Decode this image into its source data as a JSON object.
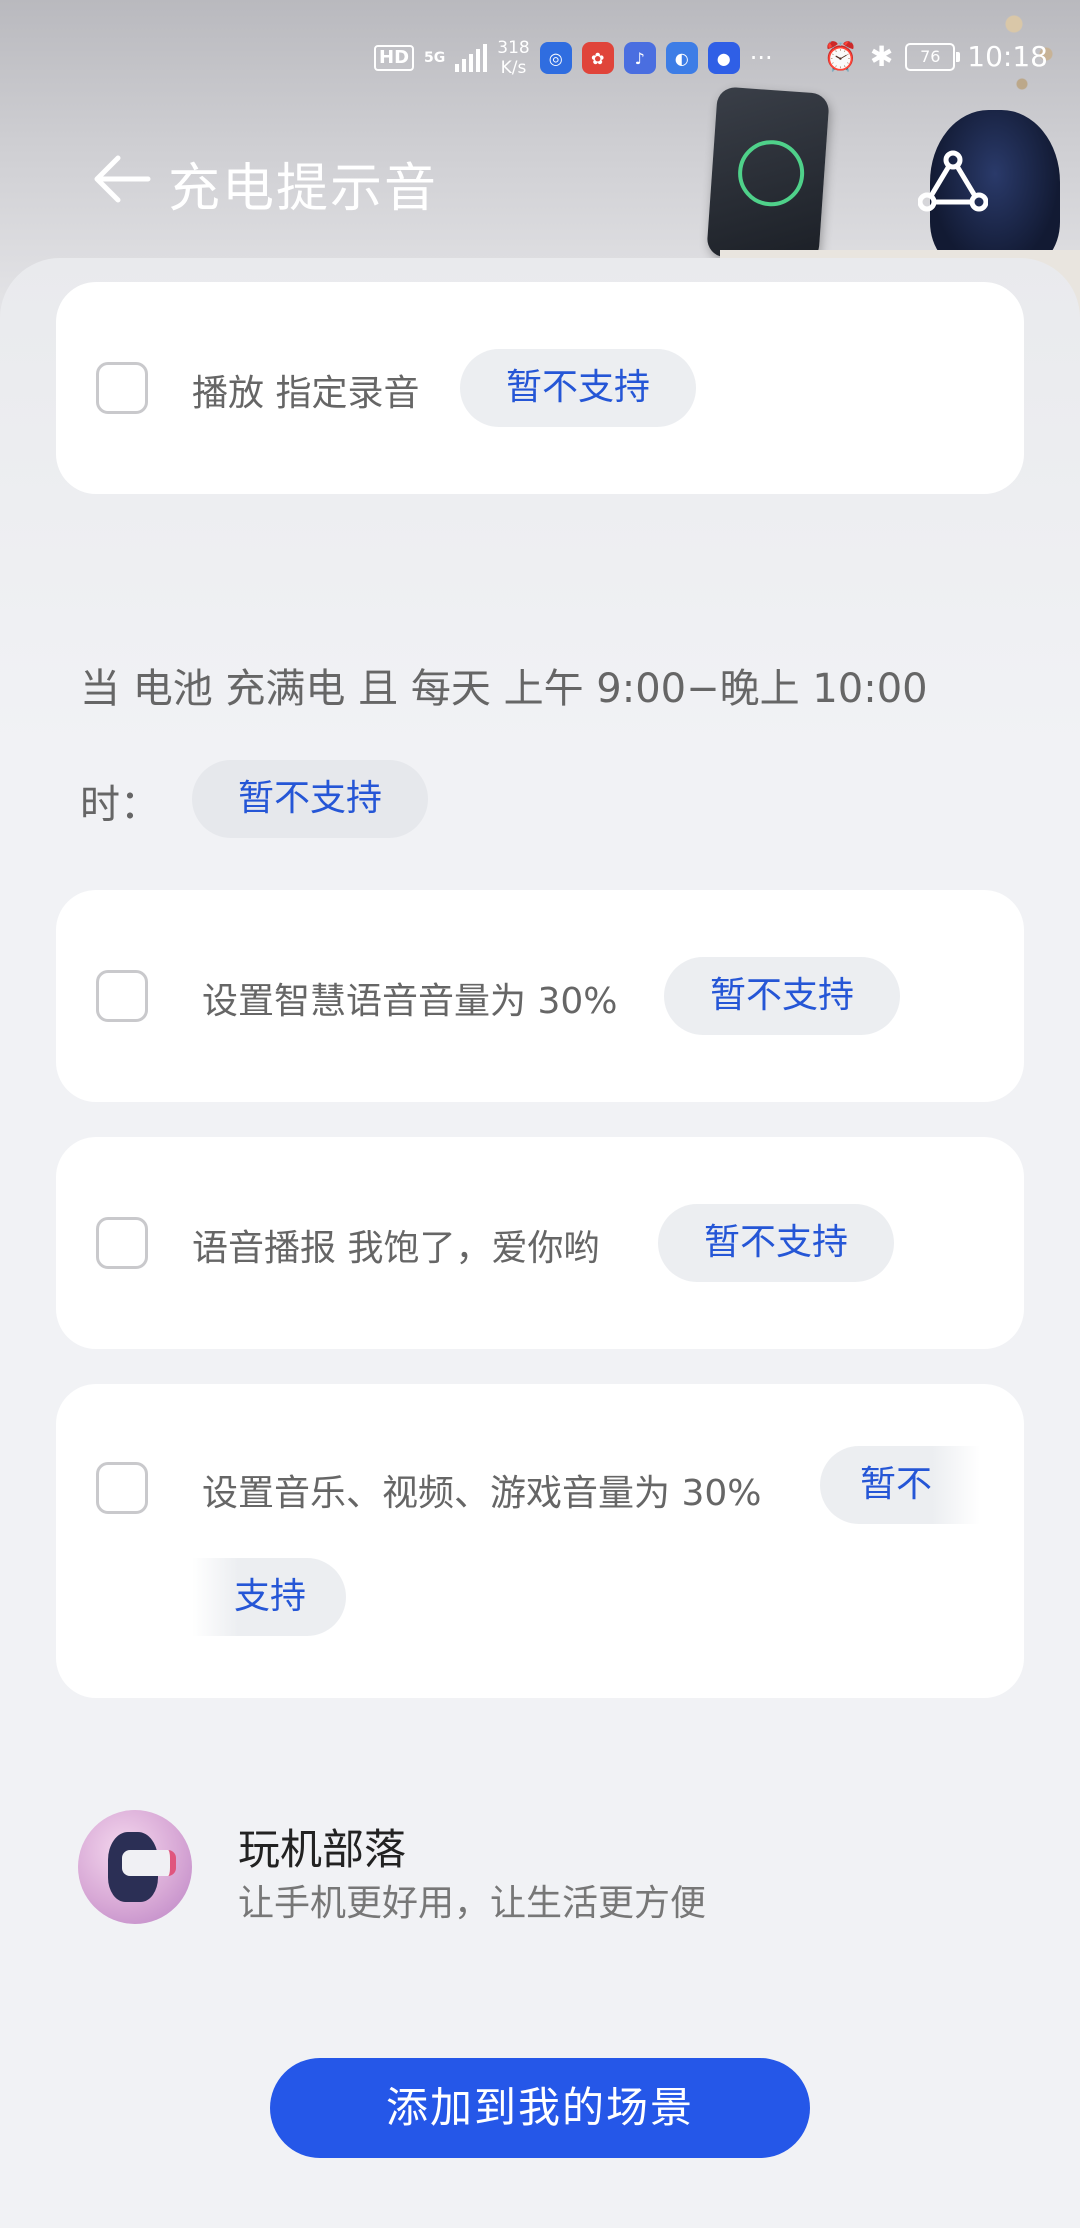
{
  "status_bar": {
    "hd": "HD",
    "network": "5G",
    "speed_value": "318",
    "speed_unit": "K/s",
    "more": "···",
    "battery": "76",
    "time": "10:18"
  },
  "header": {
    "title": "充电提示音"
  },
  "actions_group_1": [
    {
      "label": "播放 指定录音",
      "status": "暂不支持"
    }
  ],
  "condition": {
    "line1": "当 电池 充满电 且 每天 上午 9:00−晚上 10:00",
    "line2": "时：",
    "status": "暂不支持"
  },
  "actions_group_2": [
    {
      "label": "设置智慧语音音量为 30%",
      "status": "暂不支持"
    },
    {
      "label": "语音播报 我饱了，爱你哟",
      "status": "暂不支持"
    },
    {
      "label": "设置音乐、视频、游戏音量为 30%",
      "status_part1": "暂不",
      "status_part2": "支持"
    }
  ],
  "author": {
    "name": "玩机部落",
    "description": "让手机更好用，让生活更方便"
  },
  "footer": {
    "add_button_label": "添加到我的场景"
  },
  "colors": {
    "accent": "#2557e8",
    "pill_text": "#2556d6",
    "pill_bg": "#eceef1"
  }
}
